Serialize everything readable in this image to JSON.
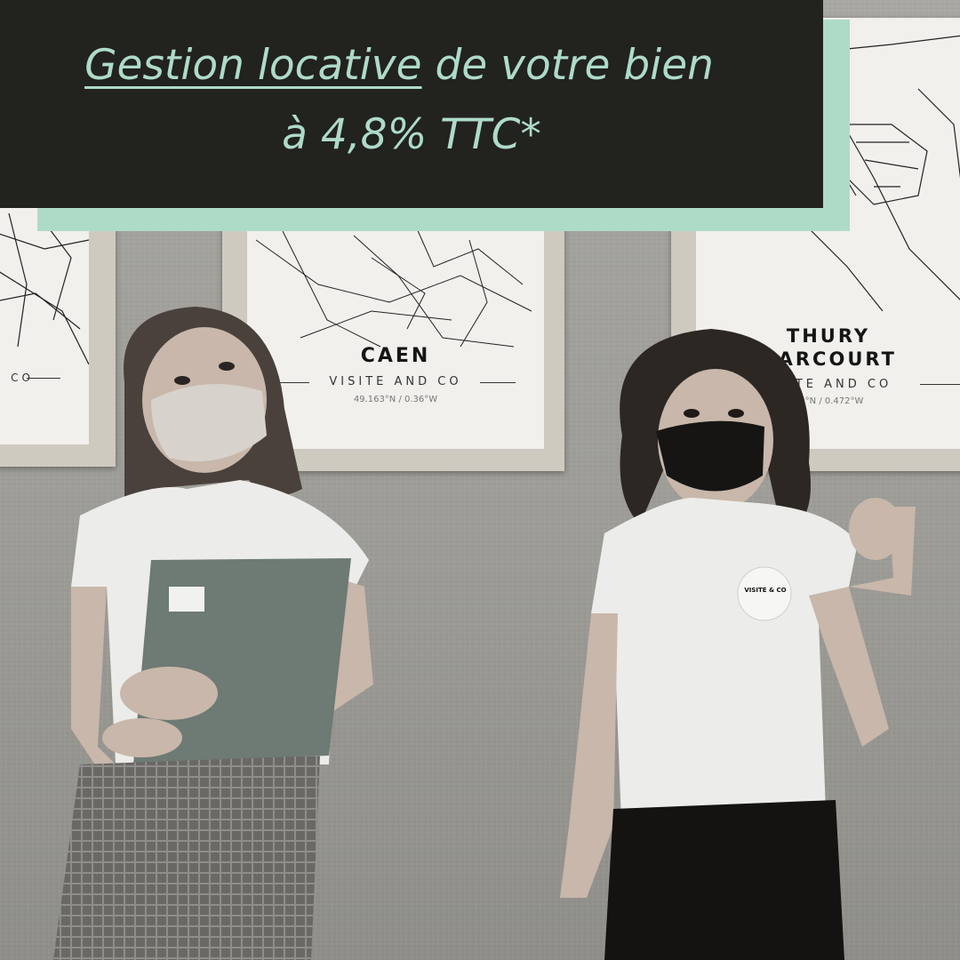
{
  "banner": {
    "headline_underlined": "Gestion locative",
    "headline_rest": " de votre bien",
    "headline_line2": "à 4,8% TTC*",
    "background_color": "#22221f",
    "text_color": "#aedbc8",
    "accent_color": "#aedbc8"
  },
  "posters": [
    {
      "city": "",
      "subtitle": "CO",
      "coords": ""
    },
    {
      "city": "CAEN",
      "subtitle": "VISITE AND CO",
      "coords": "49.163°N / 0.36°W"
    },
    {
      "city_line1": "THURY",
      "city_line2": "HARCOURT",
      "subtitle": "SITE AND CO",
      "coords": "980°N / 0.472°W"
    }
  ],
  "badge": {
    "text": "VISITE & CO"
  }
}
